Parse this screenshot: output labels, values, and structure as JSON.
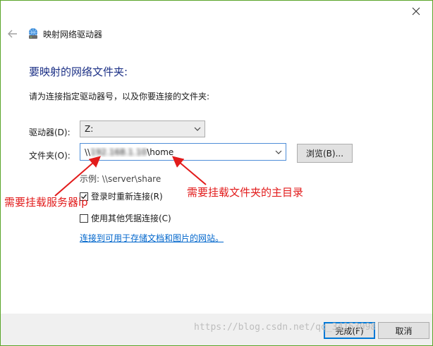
{
  "dialog": {
    "title": "映射网络驱动器",
    "heading": "要映射的网络文件夹:",
    "instruction": "请为连接指定驱动器号，以及你要连接的文件夹:"
  },
  "drive": {
    "label": "驱动器(D):",
    "value": "Z:"
  },
  "folder": {
    "label": "文件夹(O):",
    "value_prefix": "\\\\",
    "value_redacted": "192.168.1.10",
    "value_suffix": "\\home",
    "browse_label": "浏览(B)...",
    "example": "示例: \\\\server\\share"
  },
  "options": {
    "reconnect_label": "登录时重新连接(R)",
    "reconnect_checked": true,
    "other_credentials_label": "使用其他凭据连接(C)",
    "other_credentials_checked": false
  },
  "link": {
    "text": "连接到可用于存储文档和图片的网站。"
  },
  "buttons": {
    "finish": "完成(F)",
    "cancel": "取消"
  },
  "annotations": {
    "left": "需要挂载服务器ip",
    "right": "需要挂载文件夹的主目录",
    "color": "#e21b1b"
  },
  "watermark": "https://blog.csdn.net/qq_34153098",
  "icons": {
    "close": "close-icon",
    "back": "back-arrow-icon",
    "network_drive": "network-drive-icon",
    "dropdown": "chevron-down-icon",
    "check": "checkmark-icon"
  },
  "colors": {
    "accent": "#0078d7",
    "heading": "#1e3287",
    "link": "#0066cc",
    "frame": "#5aa52a"
  }
}
